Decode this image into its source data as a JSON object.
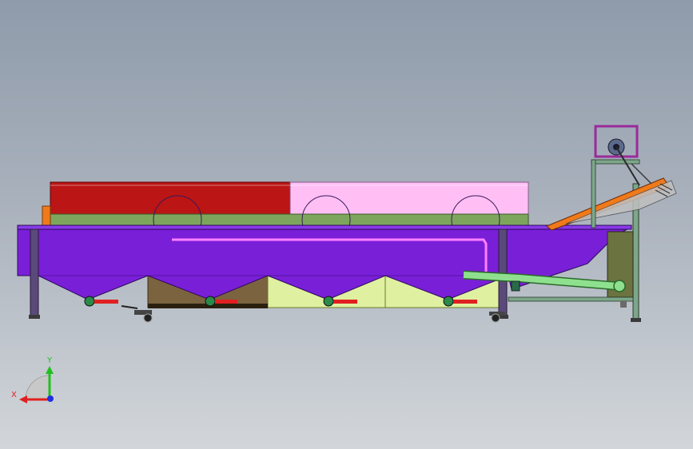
{
  "triad": {
    "x_label": "X",
    "y_label": "Y",
    "x_color": "#e02020",
    "y_color": "#20c020",
    "z_color": "#2030e0"
  },
  "colors": {
    "tank": "#7a1fd8",
    "tank_dark": "#5b14a8",
    "cover_red": "#bb1515",
    "cover_pink": "#ffbff5",
    "belt": "#7da65c",
    "hopper_brown": "#7b6340",
    "hopper_yellow": "#dff0a0",
    "orange": "#f07a1a",
    "pipe_green": "#8ee08e",
    "frame": "#5a4a7a",
    "valve_red": "#e02020",
    "motor_box": "#6b7340"
  },
  "model": {
    "drums": 3,
    "drain_valves": 4,
    "legs": 3,
    "casters": 2
  }
}
